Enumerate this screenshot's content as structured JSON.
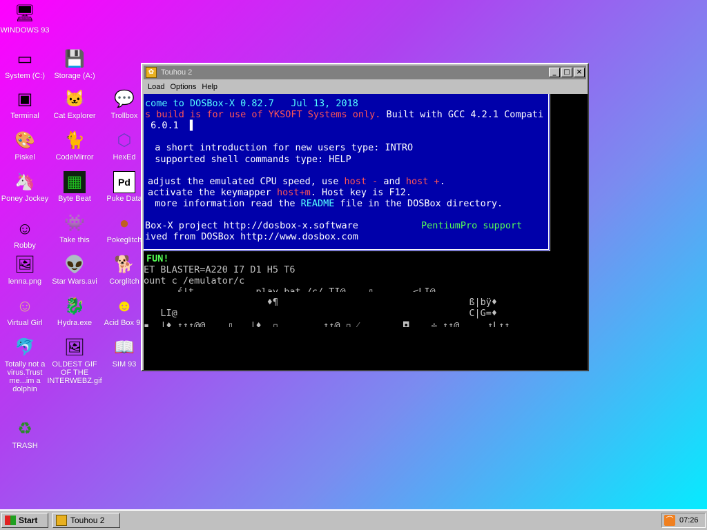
{
  "desktop": {
    "icons": [
      {
        "label": "WINDOWS 93",
        "glyph": "🖥",
        "icon": "computer-icon"
      },
      {
        "label": "System (C:)",
        "glyph": "▭",
        "icon": "drive-icon"
      },
      {
        "label": "Storage (A:)",
        "glyph": "💾",
        "icon": "floppy-icon"
      },
      {
        "label": "Terminal",
        "glyph": "▣",
        "icon": "terminal-icon"
      },
      {
        "label": "Cat Explorer",
        "glyph": "🐱",
        "icon": "cat-explorer-icon"
      },
      {
        "label": "Trollbox",
        "glyph": "💬",
        "icon": "trollbox-icon"
      },
      {
        "label": "Piskel",
        "glyph": "🎨",
        "icon": "piskel-icon"
      },
      {
        "label": "CodeMirror",
        "glyph": "🐈",
        "icon": "codemirror-icon"
      },
      {
        "label": "HexEd",
        "glyph": "⬡",
        "icon": "hexed-icon"
      },
      {
        "label": "Poney Jockey",
        "glyph": "🦄",
        "icon": "poney-icon"
      },
      {
        "label": "Byte Beat",
        "glyph": "▦",
        "icon": "bytebeat-icon"
      },
      {
        "label": "Puke Data",
        "glyph": "Pd",
        "icon": "pukedata-icon"
      },
      {
        "label": "Robby",
        "glyph": "☺",
        "icon": "robby-icon"
      },
      {
        "label": "Take this",
        "glyph": "👾",
        "icon": "takethis-icon"
      },
      {
        "label": "Pokeglitch",
        "glyph": "●",
        "icon": "pokeglitch-icon"
      },
      {
        "label": "lenna.png",
        "glyph": "🖼",
        "icon": "image-file-icon"
      },
      {
        "label": "Star Wars.avi",
        "glyph": "👽",
        "icon": "video-file-icon"
      },
      {
        "label": "Corglitch",
        "glyph": "🐕",
        "icon": "corglitch-icon"
      },
      {
        "label": "Virtual Girl",
        "glyph": "☺",
        "icon": "virtual-girl-icon"
      },
      {
        "label": "Hydra.exe",
        "glyph": "🐉",
        "icon": "hydra-icon"
      },
      {
        "label": "Acid Box 93",
        "glyph": "☻",
        "icon": "acidbox-icon"
      },
      {
        "label": "Totally not a virus.Trust me...im a dolphin",
        "glyph": "🐬",
        "icon": "dolphin-icon"
      },
      {
        "label": "OLDEST GIF OF THE INTERWEBZ.gif",
        "glyph": "🖼",
        "icon": "gif-file-icon"
      },
      {
        "label": "SIM 93",
        "glyph": "📖",
        "icon": "sim93-icon"
      },
      {
        "label": "TRASH",
        "glyph": "♻",
        "icon": "trash-icon"
      }
    ]
  },
  "window": {
    "title": "Touhou 2",
    "buttons": {
      "minimize": "_",
      "maximize": "□",
      "close": "×"
    },
    "menu": [
      "Load",
      "Options",
      "Help"
    ],
    "console": {
      "welcome": "come to DOSBox-X 0.82.7   Jul 13, 2018",
      "build_prefix": "s build is for use of YKSOFT Systems only.",
      "build_suffix": " Built with GCC 4.2.1 Compati",
      "version": " 6.0.1  ",
      "cursor": "▌",
      "intro_line": "  a short introduction for new users type: INTRO",
      "help_line": "  supported shell commands type: HELP",
      "cpu_a": "adjust the emulated CPU speed, use ",
      "cpu_host1": "host -",
      "cpu_and": " and ",
      "cpu_host2": "host +",
      "cpu_end": ".",
      "key_a": "activate the keymapper ",
      "key_host": "host+m",
      "key_end": ". Host key is F12.",
      "more_a": "  more information read the ",
      "more_readme": "README",
      "more_end": " file in the DOSBox directory.",
      "project_line": "Box-X project http://dosbox-x.software",
      "pentium": "PentiumPro support",
      "derived_line": "ived from DOSBox http://www.dosbox.com",
      "fun": "FUN!",
      "blaster": "ET BLASTER=A220 I7 D1 H5 T6",
      "mount": "ount c /emulator/c",
      "garbage1": "      ś|t           play bat /c/ TI@    ▯       <LI@",
      "garbage2a": "                      ♦¶                                  ß|bÿ♦",
      "garbage2b": "   LI@                                                    C|G=♦",
      "garbage3": "▪  |♦ ↑↑↑@@    ▯   |♦  ▫        ↑↑@ ▫ ⁄        ◘    ✢ ↑↑@     ↑L↑↑."
    }
  },
  "taskbar": {
    "start_label": "Start",
    "task_label": "Touhou 2",
    "clock": "07:26",
    "rss_glyph": "⌒"
  }
}
